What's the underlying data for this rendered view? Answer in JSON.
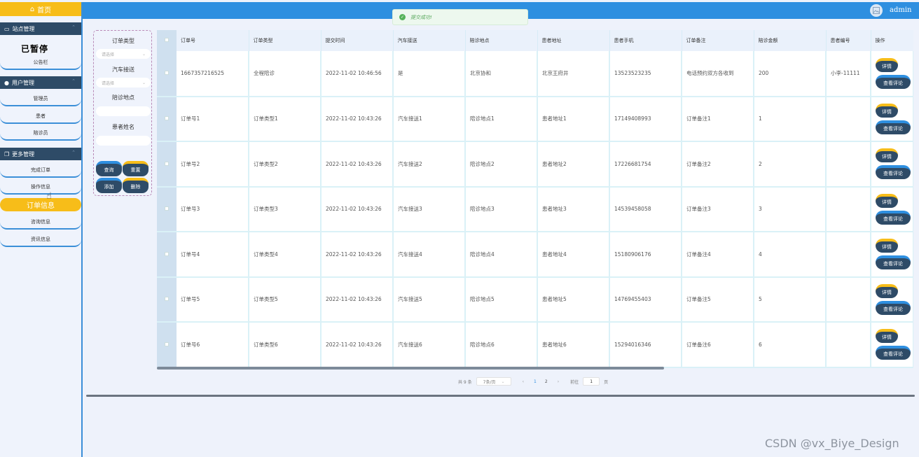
{
  "header": {
    "title": "",
    "username": "admin"
  },
  "toast": {
    "message": "提交成功!"
  },
  "sidebar": {
    "home": "首页",
    "paused_overlay": "已暂停",
    "groups": [
      {
        "title": "站点管理",
        "items": [
          "公告栏"
        ]
      },
      {
        "title": "用户管理",
        "items": [
          "管理员",
          "患者",
          "陪诊员"
        ]
      },
      {
        "title": "更多管理",
        "items": [
          "完成订单",
          "操作信息",
          "订单信息",
          "咨询信息",
          "资讯信息"
        ]
      }
    ],
    "active_item": "订单信息"
  },
  "search": {
    "order_type_label": "订单类型",
    "order_type_placeholder": "请选择",
    "car_label": "汽车接送",
    "car_placeholder": "请选择",
    "place_label": "陪诊地点",
    "patient_label": "患者姓名",
    "buttons": {
      "query": "查询",
      "reset": "重置",
      "add": "添加",
      "delete": "删除"
    }
  },
  "table": {
    "columns": [
      "订单号",
      "订单类型",
      "提交时间",
      "汽车接送",
      "陪诊地点",
      "患者地址",
      "患者手机",
      "订单备注",
      "陪诊金额",
      "患者编号",
      "操作"
    ],
    "rows": [
      [
        "1667357216525",
        "全程陪诊",
        "2022-11-02 10:46:56",
        "是",
        "北京协和",
        "北京王府井",
        "13523523235",
        "电话预约双方各收到",
        "200",
        "小李-11111"
      ],
      [
        "订单号1",
        "订单类型1",
        "2022-11-02 10:43:26",
        "汽车接送1",
        "陪诊地点1",
        "患者地址1",
        "17149408993",
        "订单备注1",
        "1",
        ""
      ],
      [
        "订单号2",
        "订单类型2",
        "2022-11-02 10:43:26",
        "汽车接送2",
        "陪诊地点2",
        "患者地址2",
        "17226681754",
        "订单备注2",
        "2",
        ""
      ],
      [
        "订单号3",
        "订单类型3",
        "2022-11-02 10:43:26",
        "汽车接送3",
        "陪诊地点3",
        "患者地址3",
        "14539458058",
        "订单备注3",
        "3",
        ""
      ],
      [
        "订单号4",
        "订单类型4",
        "2022-11-02 10:43:26",
        "汽车接送4",
        "陪诊地点4",
        "患者地址4",
        "15180906176",
        "订单备注4",
        "4",
        ""
      ],
      [
        "订单号5",
        "订单类型5",
        "2022-11-02 10:43:26",
        "汽车接送5",
        "陪诊地点5",
        "患者地址5",
        "14769455403",
        "订单备注5",
        "5",
        ""
      ],
      [
        "订单号6",
        "订单类型6",
        "2022-11-02 10:43:26",
        "汽车接送6",
        "陪诊地点6",
        "患者地址6",
        "15294016346",
        "订单备注6",
        "6",
        ""
      ]
    ],
    "row_actions": {
      "detail": "详情",
      "comments": "查看评论"
    }
  },
  "pagination": {
    "total": "共 9 条",
    "page_size": "7条/页",
    "pages": [
      "1",
      "2"
    ],
    "current_page": "1",
    "goto_prefix": "前往",
    "goto_value": "1",
    "goto_suffix": "页"
  },
  "watermark": "CSDN @vx_Biye_Design",
  "colors": {
    "accent": "#f7bd19",
    "primary": "#2e8fe0",
    "dark": "#2e4b67"
  }
}
